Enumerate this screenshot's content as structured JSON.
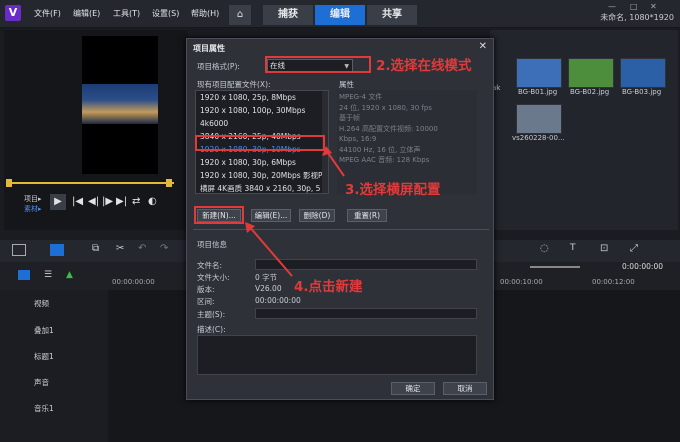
{
  "menu": [
    "文件(F)",
    "编辑(E)",
    "工具(T)",
    "设置(S)",
    "帮助(H)"
  ],
  "tabs": {
    "capture": "捕获",
    "edit": "编辑",
    "share": "共享"
  },
  "project_info": "未命名, 1080*1920",
  "preview": {
    "track_label": "项目▸",
    "clip_label": "素材▸"
  },
  "library": {
    "items": [
      {
        "label": "BG-B01.jpg",
        "color": "#3d6fb8"
      },
      {
        "label": "BG-B02.jpg",
        "color": "#4d8e3c"
      },
      {
        "label": "BG-B03.jpg",
        "color": "#2b5fa6"
      },
      {
        "label": "vs260228-00...",
        "color": "#6a7a8c"
      }
    ],
    "partial_label": "ak"
  },
  "timeline": {
    "timecode": "0:00:00:00",
    "ruler": [
      "00:00:00:00",
      "00:00:10:00",
      "00:00:12:00"
    ],
    "tracks": [
      "视频",
      "叠加1",
      "标题1",
      "声音",
      "音乐1"
    ]
  },
  "dialog": {
    "title": "项目属性",
    "format_label": "项目格式(P):",
    "format_value": "在线",
    "profiles_label": "现有项目配置文件(X):",
    "profiles": [
      "1920 x 1080, 25p, 8Mbps",
      "1920 x 1080, 100p, 30Mbps",
      "4k6000",
      "3840 x 2160, 25p, 40Mbps",
      "1920 x 1080, 30p, 10Mbps",
      "1920 x 1080, 30p, 6Mbps",
      "1920 x 1080, 30p, 20Mbps 影视PI",
      "横屏 4K画质 3840 x 2160, 30p, 5"
    ],
    "selected_profile_index": 4,
    "props_label": "属性",
    "props": [
      "MPEG-4 文件",
      "24 位, 1920 x 1080, 30 fps",
      "基于帧",
      "H.264 高配置文件视频: 10000",
      "Kbps, 16:9",
      "44100 Hz, 16 位, 立体声",
      "MPEG AAC 音频: 128 Kbps"
    ],
    "buttons": {
      "new": "新建(N)...",
      "edit": "编辑(E)...",
      "delete": "删除(D)",
      "reset": "重置(R)"
    },
    "info_title": "项目信息",
    "info": {
      "filename_label": "文件名:",
      "filesize_label": "文件大小:",
      "filesize_value": "0 字节",
      "version_label": "版本:",
      "version_value": "V26.00",
      "range_label": "区间:",
      "range_value": "00:00:00:00",
      "subject_label": "主题(S):",
      "desc_label": "描述(C):"
    },
    "ok": "确定",
    "cancel": "取消"
  },
  "annotations": {
    "step2": "2.选择在线模式",
    "step3": "3.选择横屏配置",
    "step4": "4.点击新建"
  }
}
